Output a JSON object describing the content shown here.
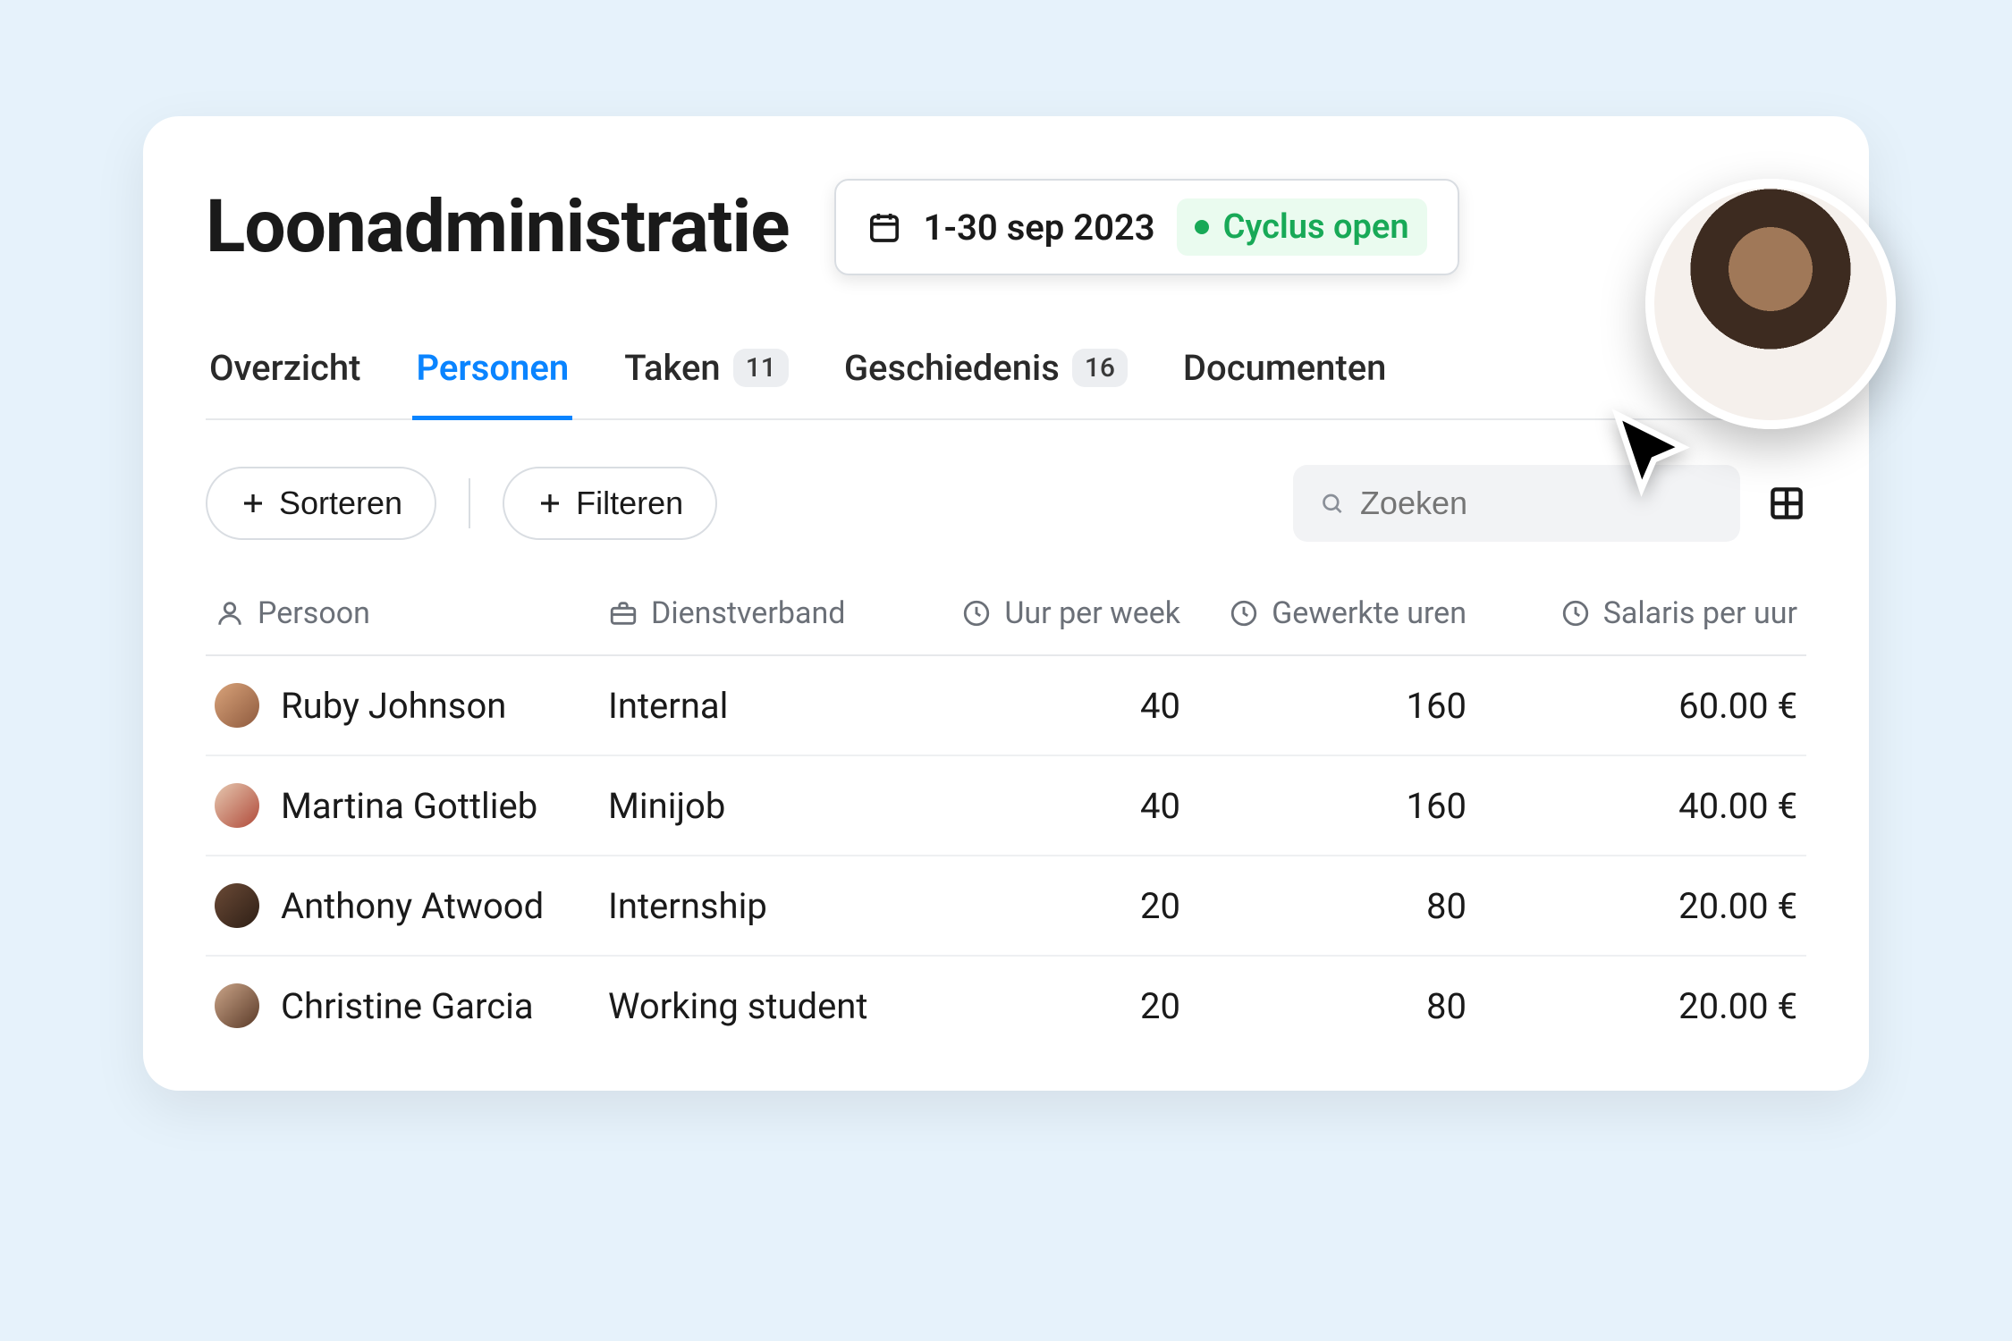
{
  "page_title": "Loonadministratie",
  "period": {
    "range_label": "1-30 sep 2023",
    "status_label": "Cyclus open",
    "status_color": "#18A957"
  },
  "tabs": [
    {
      "label": "Overzicht",
      "active": false,
      "badge": null
    },
    {
      "label": "Personen",
      "active": true,
      "badge": null
    },
    {
      "label": "Taken",
      "active": false,
      "badge": "11"
    },
    {
      "label": "Geschiedenis",
      "active": false,
      "badge": "16"
    },
    {
      "label": "Documenten",
      "active": false,
      "badge": null
    }
  ],
  "toolbar": {
    "sort_label": "Sorteren",
    "filter_label": "Filteren",
    "search_placeholder": "Zoeken"
  },
  "columns": {
    "person": "Persoon",
    "employment": "Dienstverband",
    "hours_per_week": "Uur per week",
    "worked_hours": "Gewerkte uren",
    "salary_per_hour": "Salaris per uur"
  },
  "rows": [
    {
      "name": "Ruby Johnson",
      "employment": "Internal",
      "hours_per_week": "40",
      "worked_hours": "160",
      "salary": "60.00 €"
    },
    {
      "name": "Martina Gottlieb",
      "employment": "Minijob",
      "hours_per_week": "40",
      "worked_hours": "160",
      "salary": "40.00 €"
    },
    {
      "name": "Anthony Atwood",
      "employment": "Internship",
      "hours_per_week": "20",
      "worked_hours": "80",
      "salary": "20.00 €"
    },
    {
      "name": "Christine Garcia",
      "employment": "Working student",
      "hours_per_week": "20",
      "worked_hours": "80",
      "salary": "20.00 €"
    }
  ]
}
